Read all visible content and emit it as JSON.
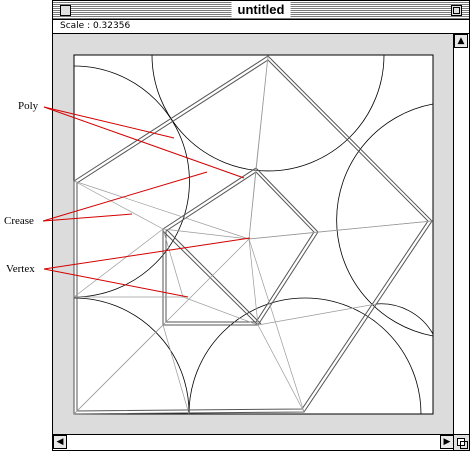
{
  "window": {
    "title": "untitled"
  },
  "info": {
    "scale_text": "Scale : 0.32356"
  },
  "callouts": {
    "poly": "Poly",
    "crease": "Crease",
    "vertex": "Vertex"
  },
  "colors": {
    "callout_lines": "#d40000",
    "paper": "#ffffff",
    "chrome": "#dcdcdc"
  },
  "icons": {
    "close": "close-box",
    "zoom": "zoom-box",
    "up": "up-arrow-icon",
    "left": "left-arrow-icon",
    "right": "right-arrow-icon",
    "grow": "size-box-icon"
  }
}
